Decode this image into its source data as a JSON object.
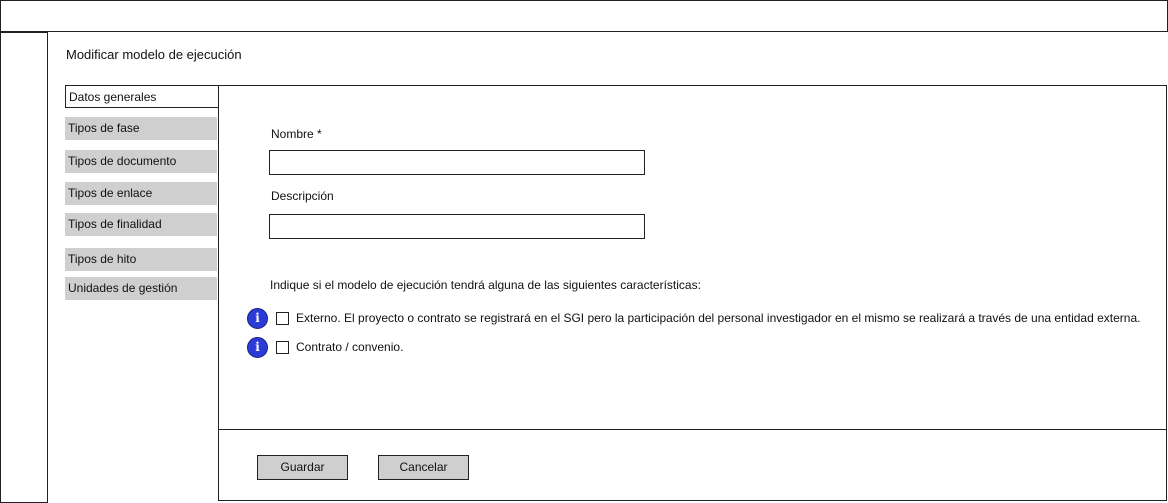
{
  "page": {
    "title": "Modificar modelo de ejecución"
  },
  "tabs": [
    {
      "label": "Datos generales",
      "active": true
    },
    {
      "label": "Tipos de fase",
      "active": false
    },
    {
      "label": "Tipos de documento",
      "active": false
    },
    {
      "label": "Tipos de enlace",
      "active": false
    },
    {
      "label": "Tipos de finalidad",
      "active": false
    },
    {
      "label": "Tipos de hito",
      "active": false
    },
    {
      "label": "Unidades de gestión",
      "active": false
    }
  ],
  "form": {
    "nombre_label": "Nombre *",
    "nombre_value": "",
    "descripcion_label": "Descripción",
    "descripcion_value": "",
    "characteristics_prompt": "Indique si el modelo de ejecución tendrá alguna de las siguientes características:",
    "info_glyph": "i",
    "options": [
      {
        "label": "Externo. El proyecto o contrato se registrará en el SGI pero la participación del personal investigador en el mismo se realizará a través de una entidad externa.",
        "checked": false
      },
      {
        "label": "Contrato / convenio.",
        "checked": false
      }
    ]
  },
  "actions": {
    "save_label": "Guardar",
    "cancel_label": "Cancelar"
  },
  "colors": {
    "tab_bg": "#cfcfcf",
    "info_icon": "#2b3bd6",
    "border": "#222222"
  }
}
